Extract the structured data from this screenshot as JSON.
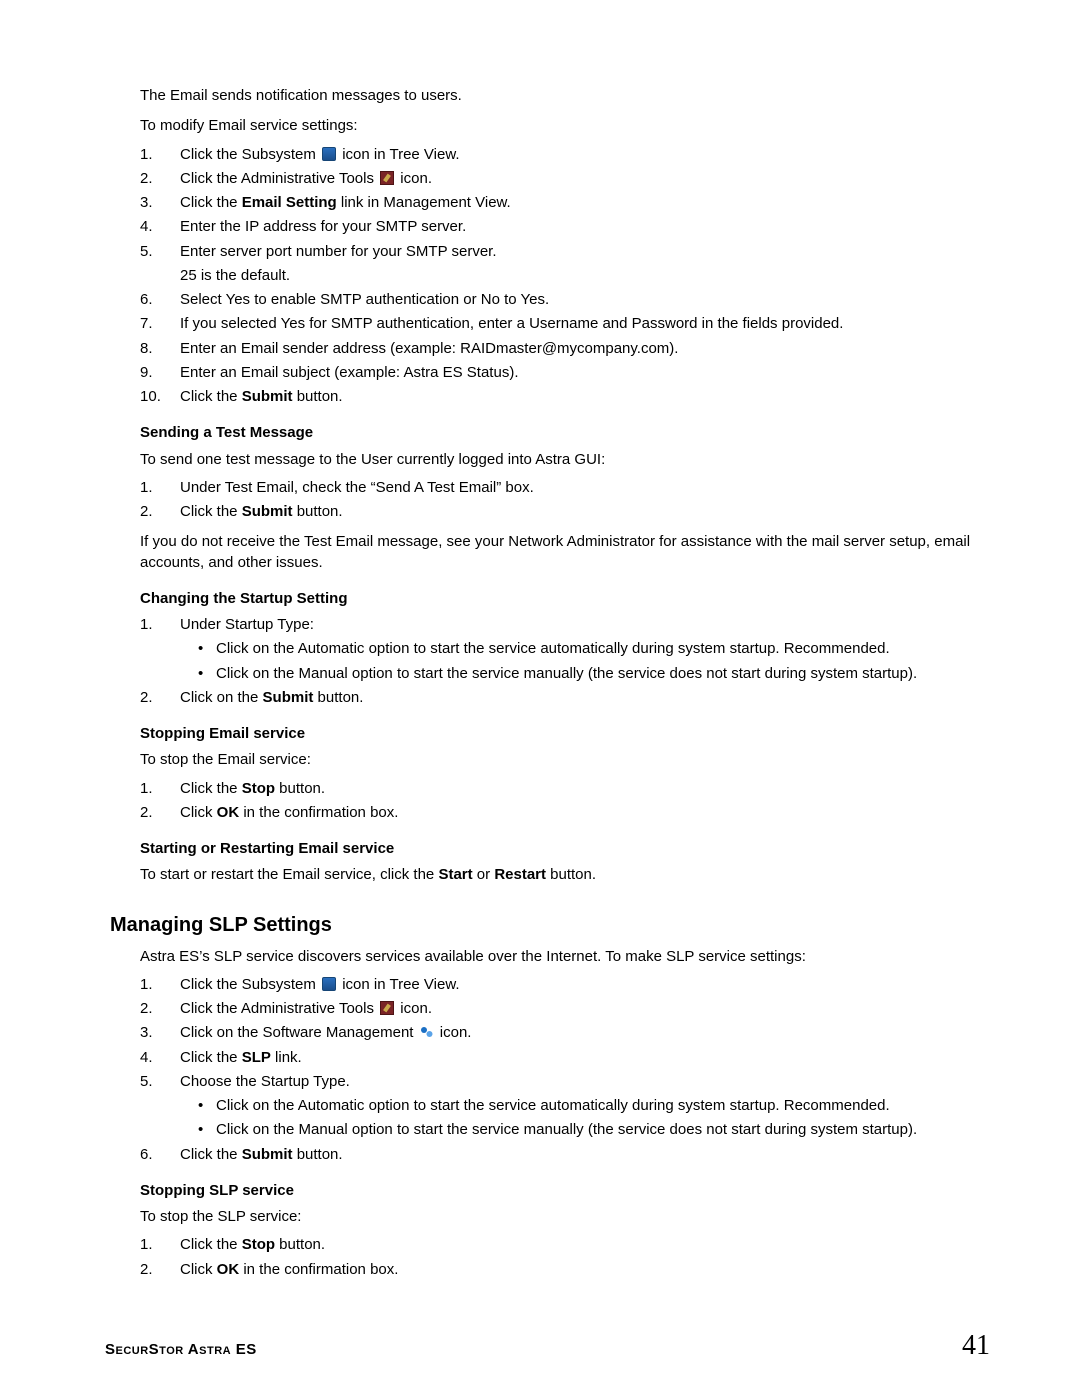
{
  "intro": {
    "p1": "The Email sends notification messages to users.",
    "p2": "To modify Email service settings:"
  },
  "emailSteps": [
    {
      "pre": "Click the Subsystem ",
      "icon": "subsystem",
      "post": " icon in Tree View."
    },
    {
      "pre": "Click the Administrative Tools ",
      "icon": "admintools",
      "post": " icon."
    },
    {
      "pre": "Click the ",
      "bold": "Email Setting",
      "post": " link in Management View."
    },
    {
      "pre": "Enter the IP address for your SMTP server."
    },
    {
      "pre": "Enter server port number for your SMTP server.",
      "sub": "25 is the default."
    },
    {
      "pre": "Select Yes to enable SMTP authentication or No to Yes."
    },
    {
      "pre": "If you selected Yes for SMTP authentication, enter a Username and Password in the fields provided."
    },
    {
      "pre": "Enter an Email sender address (example: RAIDmaster@mycompany.com)."
    },
    {
      "pre": "Enter an Email subject (example: Astra ES Status)."
    },
    {
      "pre": "Click the ",
      "bold": "Submit",
      "post": " button."
    }
  ],
  "testMsg": {
    "h": "Sending a Test Message",
    "p": "To send one test message to the User currently logged into Astra GUI:",
    "steps": [
      {
        "pre": "Under Test Email, check the “Send A Test Email” box."
      },
      {
        "pre": "Click the ",
        "bold": "Submit",
        "post": " button."
      }
    ],
    "note": "If you do not receive the Test Email message, see your Network Administrator for assistance with the mail server setup, email accounts, and other issues."
  },
  "startup": {
    "h": "Changing the Startup Setting",
    "steps": [
      {
        "pre": "Under Startup Type:",
        "bullets": [
          "Click on the Automatic option to start the service automatically during system startup. Recommended.",
          "Click on the Manual option to start the service manually (the service does not start during system startup)."
        ]
      },
      {
        "pre": "Click on the ",
        "bold": "Submit",
        "post": " button."
      }
    ]
  },
  "stopEmail": {
    "h": "Stopping Email service",
    "p": "To stop the Email service:",
    "steps": [
      {
        "pre": "Click the ",
        "bold": "Stop",
        "post": " button."
      },
      {
        "pre": "Click ",
        "bold": "OK",
        "post": " in the confirmation box."
      }
    ]
  },
  "startEmail": {
    "h": "Starting or Restarting Email service",
    "p_pre": "To start or restart the Email service, click the ",
    "b1": "Start",
    "mid": " or ",
    "b2": "Restart",
    "p_post": " button."
  },
  "slp": {
    "h2": "Managing SLP Settings",
    "intro": "Astra ES’s SLP service discovers services available over the Internet. To make SLP service settings:",
    "steps": [
      {
        "pre": "Click the Subsystem ",
        "icon": "subsystem",
        "post": " icon in Tree View."
      },
      {
        "pre": "Click the Administrative Tools ",
        "icon": "admintools",
        "post": " icon."
      },
      {
        "pre": "Click on the Software Management ",
        "icon": "software",
        "post": " icon."
      },
      {
        "pre": "Click the ",
        "bold": "SLP",
        "post": " link."
      },
      {
        "pre": "Choose the Startup Type.",
        "bullets": [
          "Click on the Automatic option to start the service automatically during system startup. Recommended.",
          "Click on the Manual option to start the service manually (the service does not start during system startup)."
        ]
      },
      {
        "pre": "Click the ",
        "bold": "Submit",
        "post": " button."
      }
    ]
  },
  "stopSlp": {
    "h": "Stopping SLP service",
    "p": "To stop the SLP service:",
    "steps": [
      {
        "pre": "Click the ",
        "bold": "Stop",
        "post": " button."
      },
      {
        "pre": "Click ",
        "bold": "OK",
        "post": " in the confirmation box."
      }
    ]
  },
  "footer": {
    "left": "SecurStor Astra ES",
    "right": "41"
  }
}
